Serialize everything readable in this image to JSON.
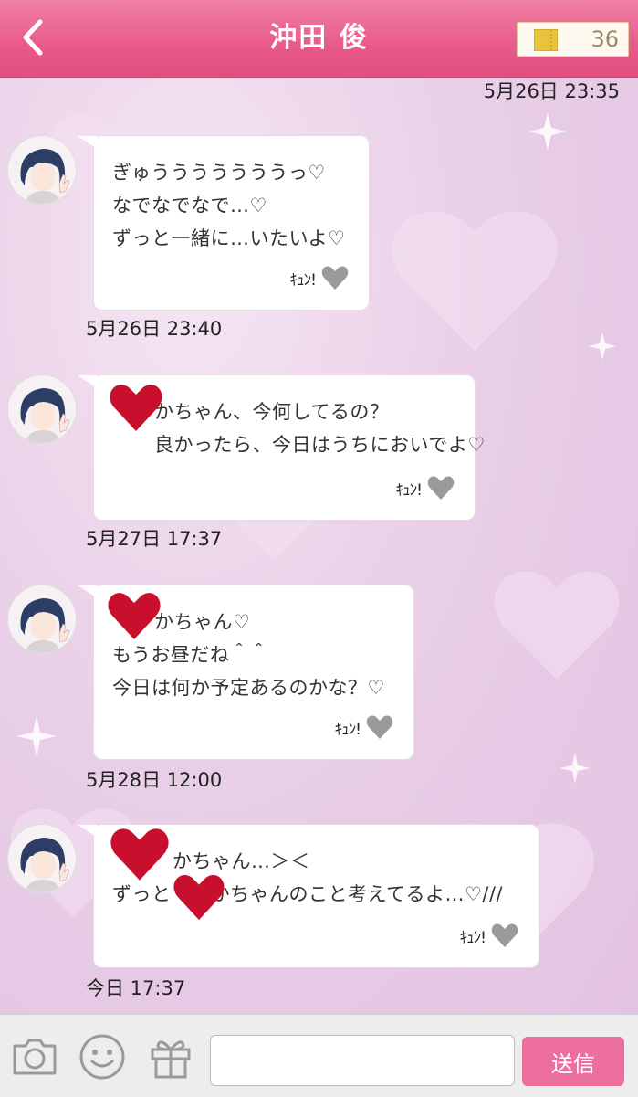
{
  "header": {
    "title": "沖田 俊",
    "ticket_count": "36"
  },
  "messages": [
    {
      "lines": "ぎゅうううううううっ♡\nなでなでなで…♡\nずっと一緒に…いたいよ♡",
      "timestamp": "5月26日 23:40"
    },
    {
      "lines": "かちゃん、今何してるの？\n良かったら、今日はうちにおいでよ♡",
      "timestamp": "5月27日 17:37"
    },
    {
      "lines": "かちゃん♡\nもうお昼だね＾＾\n今日は何か予定あるのかな？♡",
      "timestamp": "5月28日 12:00"
    },
    {
      "lines": "かちゃん…＞＜\nずっと　　かちゃんのこと考えてるよ…♡///",
      "timestamp": "今日 17:37"
    }
  ],
  "top_timestamp": "5月26日 23:35",
  "kyun_label": "ｷｭﾝ!",
  "footer": {
    "input_value": "",
    "input_placeholder": "",
    "send_label": "送信"
  },
  "icons": [
    "back-arrow-icon",
    "ticket-icon",
    "heart-icon",
    "camera-icon",
    "smiley-icon",
    "gift-icon"
  ],
  "colors": {
    "header": "#e85a8c",
    "send_button": "#ec6f9f",
    "redaction_heart": "#c8102e"
  }
}
